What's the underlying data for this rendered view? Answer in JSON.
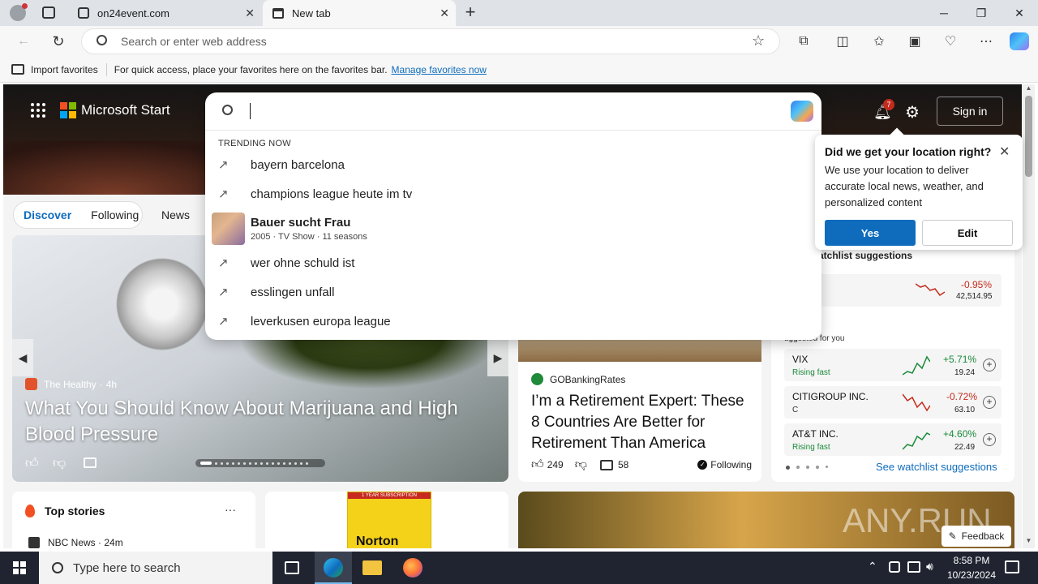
{
  "browser": {
    "tabs": [
      {
        "title": "on24event.com"
      },
      {
        "title": "New tab"
      }
    ],
    "address_placeholder": "Search or enter web address",
    "favorites_bar": {
      "import_label": "Import favorites",
      "hint": "For quick access, place your favorites here on the favorites bar.",
      "manage_link": "Manage favorites now"
    }
  },
  "msn": {
    "brand": "Microsoft Start",
    "notification_count": "7",
    "sign_in": "Sign in",
    "nav": {
      "discover": "Discover",
      "following": "Following",
      "news": "News"
    }
  },
  "search_dropdown": {
    "trending_header": "TRENDING NOW",
    "items": [
      {
        "text": "bayern barcelona"
      },
      {
        "text": "champions league heute im tv"
      },
      {
        "text": "Bauer sucht Frau",
        "sub": "2005 · TV Show · 11 seasons"
      },
      {
        "text": "wer ohne schuld ist"
      },
      {
        "text": "esslingen unfall"
      },
      {
        "text": "leverkusen europa league"
      }
    ]
  },
  "location_popup": {
    "title": "Did we get your location right?",
    "body": "We use your location to deliver accurate local news, weather, and personalized content",
    "yes": "Yes",
    "edit": "Edit"
  },
  "main_story": {
    "source": "The Healthy",
    "age": "4h",
    "headline": "What You Should Know About Marijuana and High Blood Pressure"
  },
  "second_story": {
    "source": "GOBankingRates",
    "headline": "I’m a Retirement Expert: These 8 Countries Are Better for Retirement Than America",
    "likes": "249",
    "comments": "58",
    "following": "Following"
  },
  "watchlist": {
    "header": "atchlist suggestions",
    "top_change": "-0.95%",
    "top_value": "42,514.95",
    "suggested_label": "uggested for you",
    "stocks": [
      {
        "name": "VIX",
        "sub": "Rising fast",
        "change": "+5.71%",
        "value": "19.24",
        "color": "#1a8a3a"
      },
      {
        "name": "CITIGROUP INC.",
        "sub": "C",
        "change": "-0.72%",
        "value": "63.10",
        "color": "#c42b1c"
      },
      {
        "name": "AT&T INC.",
        "sub": "Rising fast",
        "change": "+4.60%",
        "value": "22.49",
        "color": "#1a8a3a"
      }
    ],
    "see_link": "See watchlist suggestions"
  },
  "top_stories": {
    "title": "Top stories",
    "more": "···",
    "first_source": "NBC News · 24m"
  },
  "ad": {
    "label": "1 YEAR SUBSCRIPTION",
    "brand": "Norton"
  },
  "feedback": "Feedback",
  "watermark": "ANY.RUN",
  "taskbar": {
    "search_placeholder": "Type here to search",
    "time": "8:58 PM",
    "date": "10/23/2024"
  },
  "colors": {
    "accent": "#0f6cbd",
    "msn_red": "#f25022",
    "msn_green": "#7fba00",
    "msn_blue": "#00a4ef",
    "msn_yellow": "#ffb900"
  }
}
